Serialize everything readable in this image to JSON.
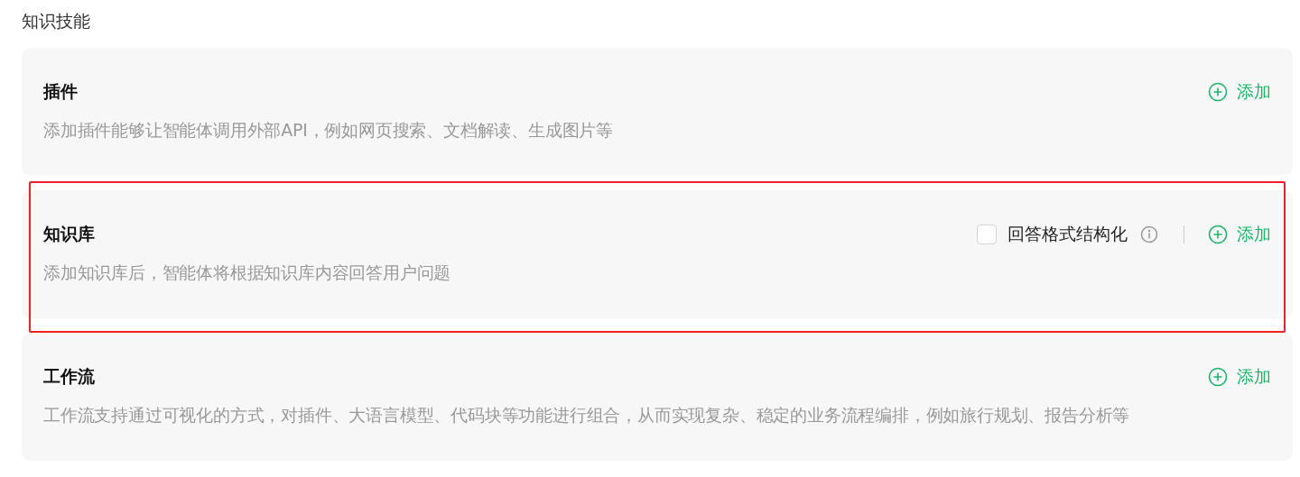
{
  "heading": "知识技能",
  "sections": [
    {
      "title": "插件",
      "description": "添加插件能够让智能体调用外部API，例如网页搜索、文档解读、生成图片等",
      "add_label": "添加",
      "highlighted": false
    },
    {
      "title": "知识库",
      "description": "添加知识库后，智能体将根据知识库内容回答用户问题",
      "add_label": "添加",
      "highlighted": true,
      "option": {
        "label": "回答格式结构化",
        "checked": false
      }
    },
    {
      "title": "工作流",
      "description": "工作流支持通过可视化的方式，对插件、大语言模型、代码块等功能进行组合，从而实现复杂、稳定的业务流程编排，例如旅行规划、报告分析等",
      "add_label": "添加",
      "highlighted": false
    }
  ]
}
